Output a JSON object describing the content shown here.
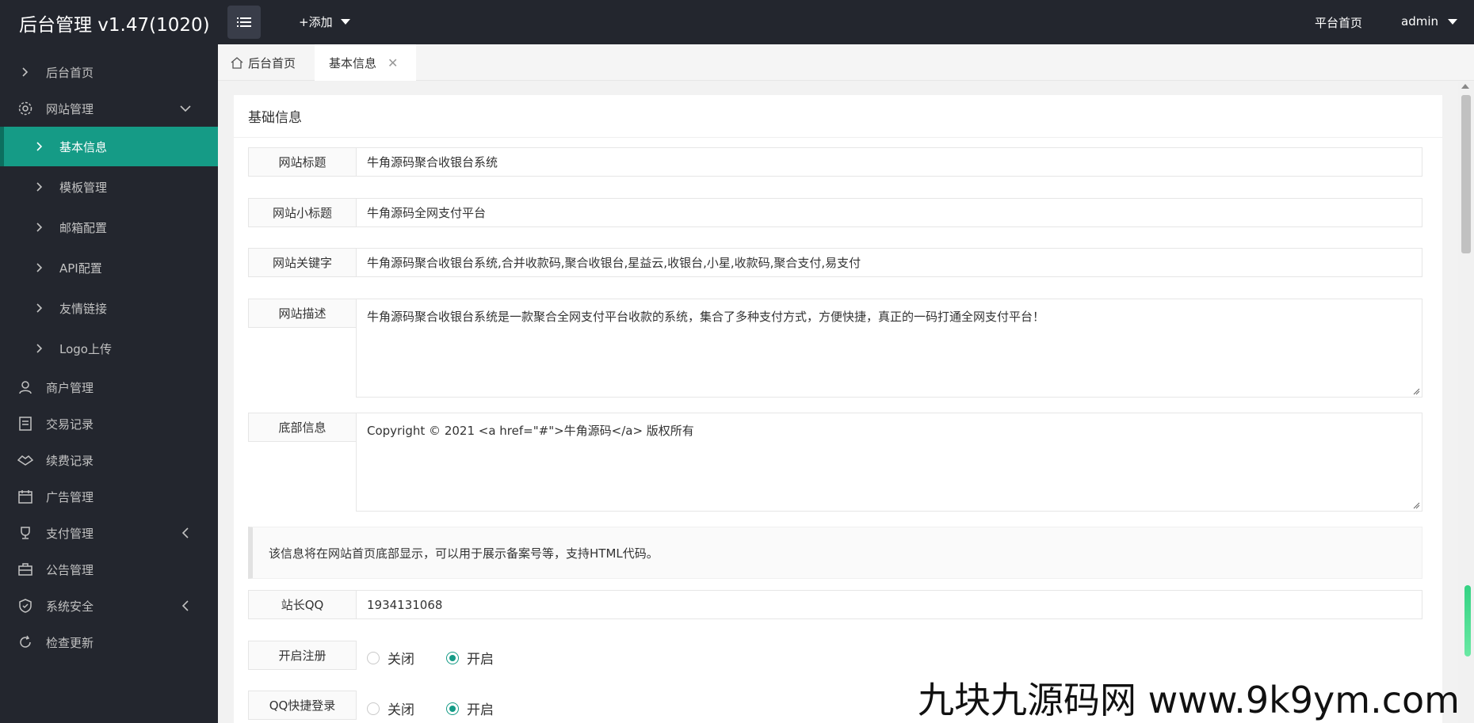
{
  "header": {
    "brand": "后台管理 v1.47(1020)",
    "add_label": "+添加",
    "home_link": "平台首页",
    "user": "admin"
  },
  "sidebar": {
    "items": [
      {
        "label": "后台首页",
        "icon": "chevron-right-icon"
      },
      {
        "label": "网站管理",
        "icon": "gear-icon",
        "expanded": true
      },
      {
        "label": "基本信息",
        "icon": "chevron-right-icon",
        "active": true
      },
      {
        "label": "模板管理",
        "icon": "chevron-right-icon"
      },
      {
        "label": "邮箱配置",
        "icon": "chevron-right-icon"
      },
      {
        "label": "API配置",
        "icon": "chevron-right-icon"
      },
      {
        "label": "友情链接",
        "icon": "chevron-right-icon"
      },
      {
        "label": "Logo上传",
        "icon": "chevron-right-icon"
      },
      {
        "label": "商户管理",
        "icon": "user-icon"
      },
      {
        "label": "交易记录",
        "icon": "receipt-icon"
      },
      {
        "label": "续费记录",
        "icon": "handshake-icon"
      },
      {
        "label": "广告管理",
        "icon": "calendar-icon"
      },
      {
        "label": "支付管理",
        "icon": "trophy-icon"
      },
      {
        "label": "公告管理",
        "icon": "briefcase-icon"
      },
      {
        "label": "系统安全",
        "icon": "shield-icon"
      },
      {
        "label": "检查更新",
        "icon": "refresh-icon"
      }
    ]
  },
  "tabs": {
    "home": "后台首页",
    "current": "基本信息"
  },
  "card": {
    "title": "基础信息"
  },
  "form": {
    "site_title": {
      "label": "网站标题",
      "value": "牛角源码聚合收银台系统"
    },
    "site_subtitle": {
      "label": "网站小标题",
      "value": "牛角源码全网支付平台"
    },
    "site_keywords": {
      "label": "网站关键字",
      "value": "牛角源码聚合收银台系统,合并收款码,聚合收银台,星益云,收银台,小星,收款码,聚合支付,易支付"
    },
    "site_description": {
      "label": "网站描述",
      "value": "牛角源码聚合收银台系统是一款聚合全网支付平台收款的系统，集合了多种支付方式，方便快捷，真正的一码打通全网支付平台！"
    },
    "footer_info": {
      "label": "底部信息",
      "value": "Copyright © 2021 <a href=\"#\">牛角源码</a> 版权所有"
    },
    "footer_hint": "该信息将在网站首页底部显示，可以用于展示备案号等，支持HTML代码。",
    "admin_qq": {
      "label": "站长QQ",
      "value": "1934131068"
    },
    "register": {
      "label": "开启注册",
      "off": "关闭",
      "on": "开启",
      "selected": "on"
    },
    "qq_login": {
      "label": "QQ快捷登录",
      "off": "关闭",
      "on": "开启",
      "selected": "on"
    }
  },
  "watermark": "九块九源码网 www.9k9ym.com",
  "colors": {
    "accent": "#159b86",
    "sidebar_bg": "#23262e"
  }
}
